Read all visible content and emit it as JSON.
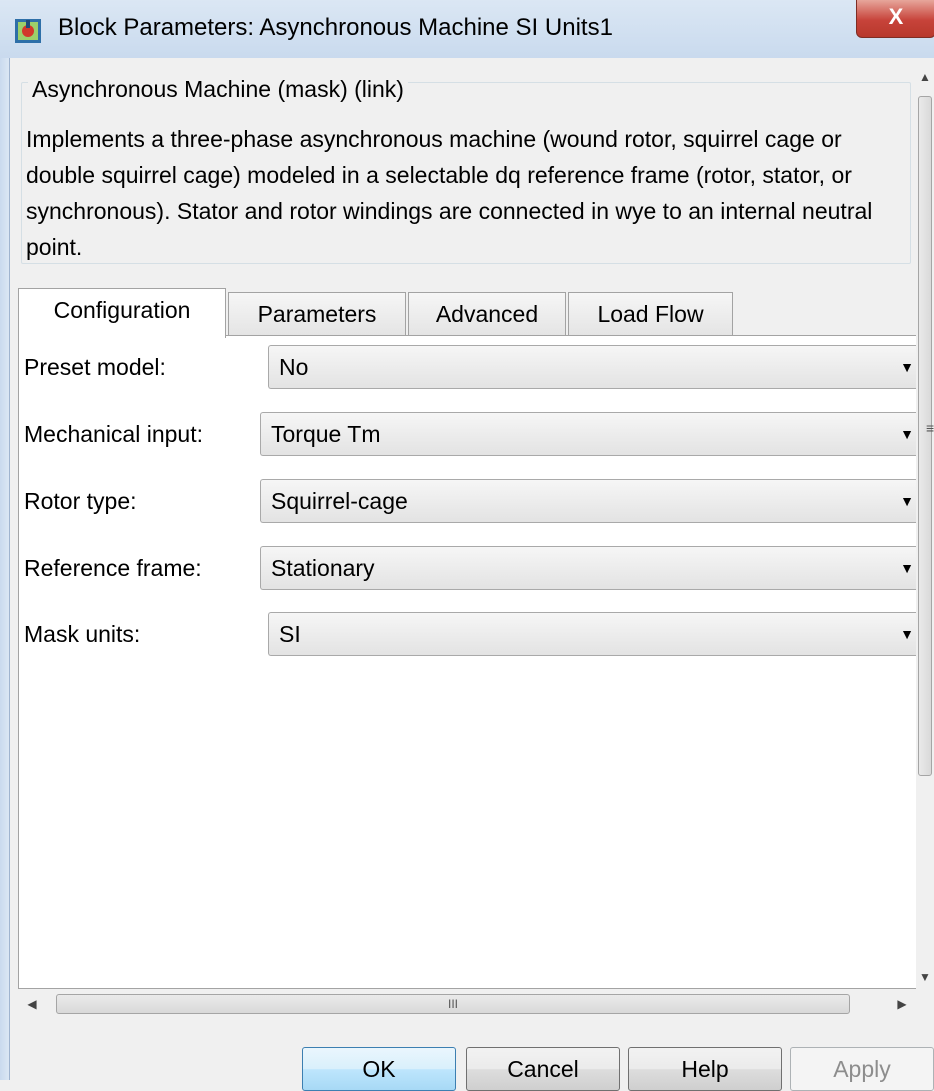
{
  "window": {
    "title": "Block Parameters: Asynchronous Machine SI Units1",
    "close_label": "X"
  },
  "description": {
    "legend": "Asynchronous Machine (mask) (link)",
    "text": "Implements a three-phase asynchronous machine (wound rotor, squirrel cage or double squirrel cage) modeled in a selectable dq reference frame (rotor, stator, or synchronous). Stator and rotor windings are connected in wye to an internal neutral point."
  },
  "tabs": [
    {
      "label": "Configuration",
      "active": true
    },
    {
      "label": "Parameters",
      "active": false
    },
    {
      "label": "Advanced",
      "active": false
    },
    {
      "label": "Load Flow",
      "active": false
    }
  ],
  "fields": {
    "preset_model": {
      "label": "Preset model:",
      "value": "No"
    },
    "mechanical_input": {
      "label": "Mechanical input:",
      "value": "Torque Tm"
    },
    "rotor_type": {
      "label": "Rotor type:",
      "value": "Squirrel-cage"
    },
    "reference_frame": {
      "label": "Reference frame:",
      "value": "Stationary"
    },
    "mask_units": {
      "label": "Mask units:",
      "value": "SI"
    }
  },
  "scroll": {
    "h_thumb_grip": "III"
  },
  "buttons": {
    "ok": "OK",
    "cancel": "Cancel",
    "help": "Help",
    "apply": "Apply"
  },
  "icons": {
    "app": "simulink-block-icon",
    "dropdown_arrow": "caret-down-icon"
  }
}
